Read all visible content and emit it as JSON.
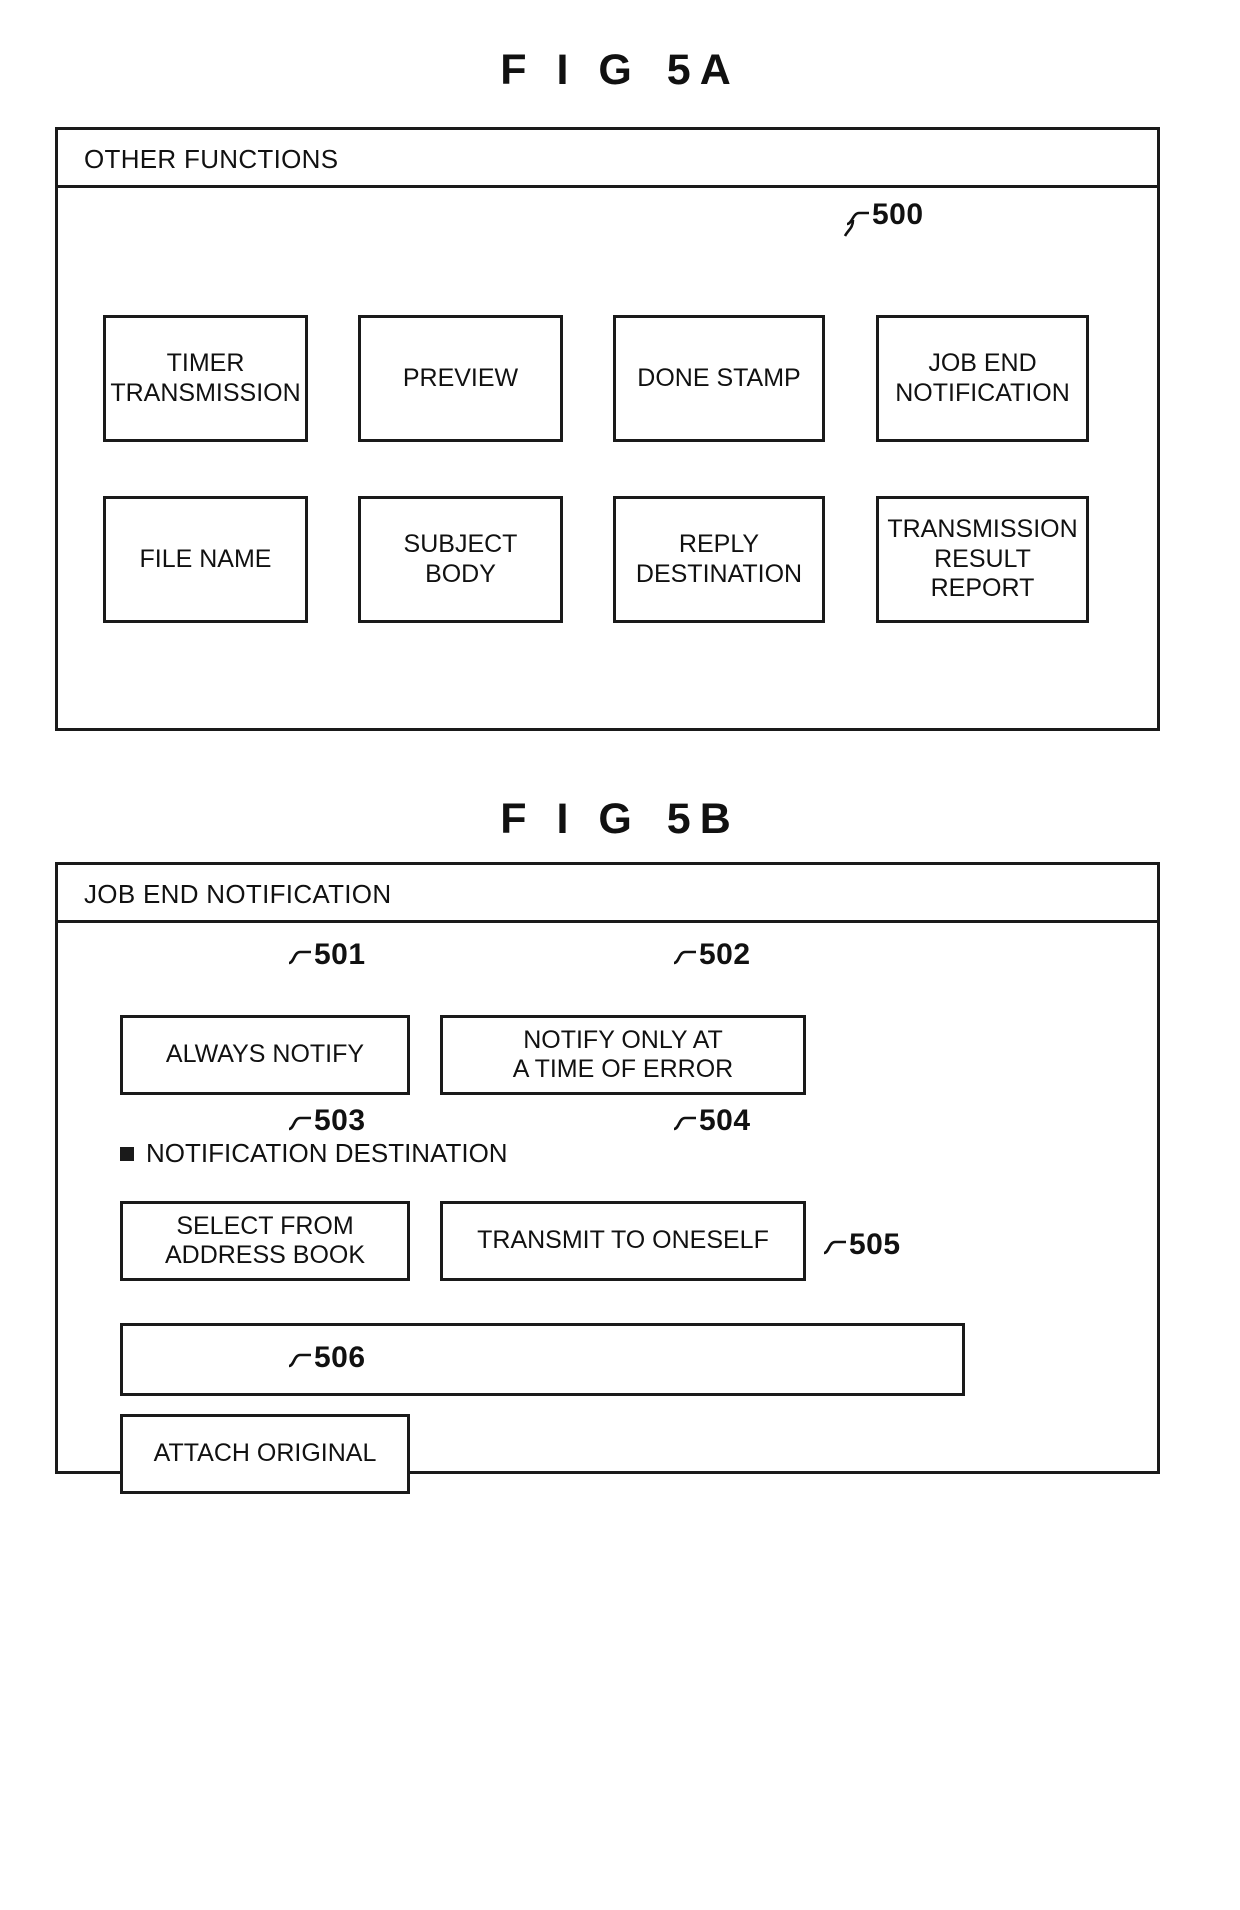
{
  "figures": [
    {
      "id": "fig-5a",
      "title_parts": {
        "fig": "F I G",
        "number": "5A"
      },
      "panel": {
        "header_label": "OTHER FUNCTIONS",
        "reference": "500",
        "buttons": [
          {
            "label": "TIMER\nTRANSMISSION",
            "name": "timer-transmission"
          },
          {
            "label": "PREVIEW",
            "name": "preview"
          },
          {
            "label": "DONE STAMP",
            "name": "done-stamp"
          },
          {
            "label": "JOB END\nNOTIFICATION",
            "name": "job-end-notification"
          },
          {
            "label": "FILE NAME",
            "name": "file-name"
          },
          {
            "label": "SUBJECT\nBODY",
            "name": "subject-body"
          },
          {
            "label": "REPLY\nDESTINATION",
            "name": "reply-destination"
          },
          {
            "label": "TRANSMISSION\nRESULT\nREPORT",
            "name": "transmission-result-report"
          }
        ]
      }
    },
    {
      "id": "fig-5b",
      "title_parts": {
        "fig": "F I G",
        "number": "5B"
      },
      "panel": {
        "header_label": "JOB END NOTIFICATION",
        "section_label": "NOTIFICATION DESTINATION",
        "buttons": [
          {
            "label": "ALWAYS NOTIFY",
            "name": "always-notify",
            "reference": "501"
          },
          {
            "label": "NOTIFY ONLY AT\nA TIME OF ERROR",
            "name": "notify-only-at-a-time-of-error",
            "reference": "502"
          },
          {
            "label": "SELECT FROM\nADDRESS BOOK",
            "name": "select-from-address-book",
            "reference": "503"
          },
          {
            "label": "TRANSMIT TO ONESELF",
            "name": "transmit-to-oneself",
            "reference": "504"
          },
          {
            "label": "ATTACH ORIGINAL",
            "name": "attach-original",
            "reference": "506"
          }
        ],
        "address_field": {
          "value": "",
          "reference": "505"
        }
      }
    }
  ],
  "colors": {
    "ink": "#1a1a1a",
    "text": "#111111",
    "paper": "#ffffff"
  }
}
